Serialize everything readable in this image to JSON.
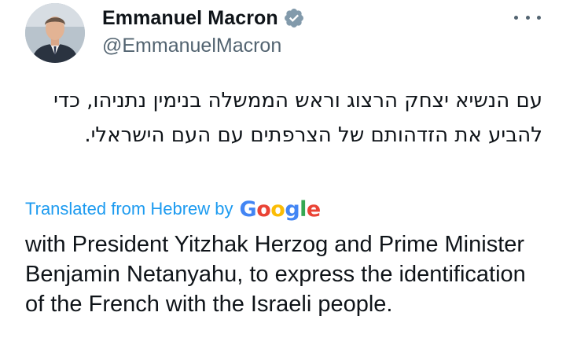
{
  "author": {
    "name": "Emmanuel Macron",
    "handle": "@EmmanuelMacron",
    "verified_color": "#829aab"
  },
  "tweet": {
    "hebrew_text": "עם הנשיא יצחק הרצוג וראש הממשלה בנימין נתניהו, כדי להביע את  הזדהותם של הצרפתים עם העם הישראלי.",
    "translated_label": "Translated from Hebrew by",
    "translation_provider": "Google",
    "translation_text": "with President Yitzhak Herzog and Prime Minister Benjamin Netanyahu, to express the identification of the French with the Israeli people."
  },
  "icons": {
    "more": "more-options-icon",
    "verified": "verified-badge-icon"
  },
  "colors": {
    "link": "#1d9bf0",
    "secondary_text": "#536471",
    "primary_text": "#0f1419"
  }
}
